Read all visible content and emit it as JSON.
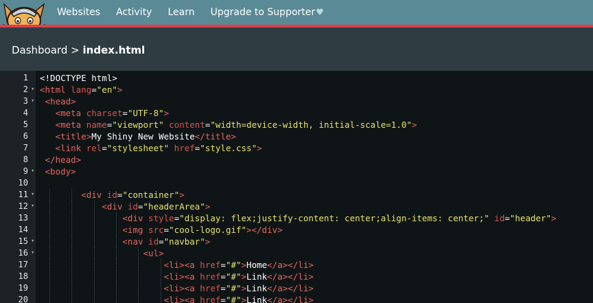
{
  "nav": {
    "items": [
      {
        "label": "Websites"
      },
      {
        "label": "Activity"
      },
      {
        "label": "Learn"
      },
      {
        "label": "Upgrade to Supporter"
      }
    ],
    "heart": "♥"
  },
  "breadcrumb": {
    "parent": "Dashboard",
    "separator": ">",
    "current": "index.html"
  },
  "editor": {
    "lines": [
      {
        "num": "1",
        "fold": "",
        "indent": 0,
        "tokens": [
          {
            "c": "x",
            "t": "<!DOCTYPE html>"
          }
        ]
      },
      {
        "num": "2",
        "fold": "▾",
        "indent": 0,
        "tokens": [
          {
            "c": "t",
            "t": "<html "
          },
          {
            "c": "a",
            "t": "lang"
          },
          {
            "c": "x",
            "t": "="
          },
          {
            "c": "s",
            "t": "\"en\""
          },
          {
            "c": "t",
            "t": ">"
          }
        ]
      },
      {
        "num": "3",
        "fold": "▾",
        "indent": 0,
        "tokens": [
          {
            "c": "t",
            "t": " <head>"
          }
        ]
      },
      {
        "num": "4",
        "fold": "",
        "indent": 0,
        "tokens": [
          {
            "c": "t",
            "t": "   <meta "
          },
          {
            "c": "a",
            "t": "charset"
          },
          {
            "c": "x",
            "t": "="
          },
          {
            "c": "s",
            "t": "\"UTF-8\""
          },
          {
            "c": "t",
            "t": ">"
          }
        ]
      },
      {
        "num": "5",
        "fold": "",
        "indent": 0,
        "tokens": [
          {
            "c": "t",
            "t": "   <meta "
          },
          {
            "c": "a",
            "t": "name"
          },
          {
            "c": "x",
            "t": "="
          },
          {
            "c": "s",
            "t": "\"viewport\""
          },
          {
            "c": "a",
            "t": " content"
          },
          {
            "c": "x",
            "t": "="
          },
          {
            "c": "s",
            "t": "\"width=device-width, initial-scale=1.0\""
          },
          {
            "c": "t",
            "t": ">"
          }
        ]
      },
      {
        "num": "6",
        "fold": "",
        "indent": 0,
        "tokens": [
          {
            "c": "t",
            "t": "   <title>"
          },
          {
            "c": "x",
            "t": "My Shiny New Website"
          },
          {
            "c": "t",
            "t": "</title>"
          }
        ]
      },
      {
        "num": "7",
        "fold": "",
        "indent": 0,
        "tokens": [
          {
            "c": "t",
            "t": "   <link "
          },
          {
            "c": "a",
            "t": "rel"
          },
          {
            "c": "x",
            "t": "="
          },
          {
            "c": "s",
            "t": "\"stylesheet\""
          },
          {
            "c": "a",
            "t": " href"
          },
          {
            "c": "x",
            "t": "="
          },
          {
            "c": "s",
            "t": "\"style.css\""
          },
          {
            "c": "t",
            "t": ">"
          }
        ]
      },
      {
        "num": "8",
        "fold": "",
        "indent": 0,
        "tokens": [
          {
            "c": "t",
            "t": " </head>"
          }
        ]
      },
      {
        "num": "9",
        "fold": "▾",
        "indent": 0,
        "tokens": [
          {
            "c": "t",
            "t": " <body>"
          }
        ]
      },
      {
        "num": "10",
        "fold": "",
        "indent": 0,
        "tokens": []
      },
      {
        "num": "11",
        "fold": "▾",
        "indent": 2,
        "tokens": [
          {
            "c": "t",
            "t": "        <div "
          },
          {
            "c": "a",
            "t": "id"
          },
          {
            "c": "x",
            "t": "="
          },
          {
            "c": "s",
            "t": "\"container\""
          },
          {
            "c": "t",
            "t": ">"
          }
        ]
      },
      {
        "num": "12",
        "fold": "▾",
        "indent": 3,
        "tokens": [
          {
            "c": "t",
            "t": "            <div "
          },
          {
            "c": "a",
            "t": "id"
          },
          {
            "c": "x",
            "t": "="
          },
          {
            "c": "s",
            "t": "\"headerArea\""
          },
          {
            "c": "t",
            "t": ">"
          }
        ]
      },
      {
        "num": "13",
        "fold": "",
        "indent": 4,
        "tokens": [
          {
            "c": "t",
            "t": "                <div "
          },
          {
            "c": "a",
            "t": "style"
          },
          {
            "c": "x",
            "t": "="
          },
          {
            "c": "s",
            "t": "\"display: flex;justify-content: center;align-items: center;\""
          },
          {
            "c": "a",
            "t": " id"
          },
          {
            "c": "x",
            "t": "="
          },
          {
            "c": "s",
            "t": "\"header\""
          },
          {
            "c": "t",
            "t": ">"
          }
        ]
      },
      {
        "num": "14",
        "fold": "",
        "indent": 4,
        "tokens": [
          {
            "c": "t",
            "t": "                <img "
          },
          {
            "c": "a",
            "t": "src"
          },
          {
            "c": "x",
            "t": "="
          },
          {
            "c": "s",
            "t": "\"cool-logo.gif\""
          },
          {
            "c": "t",
            "t": "></div>"
          }
        ]
      },
      {
        "num": "15",
        "fold": "▾",
        "indent": 4,
        "tokens": [
          {
            "c": "t",
            "t": "                <nav "
          },
          {
            "c": "a",
            "t": "id"
          },
          {
            "c": "x",
            "t": "="
          },
          {
            "c": "s",
            "t": "\"navbar\""
          },
          {
            "c": "t",
            "t": ">"
          }
        ]
      },
      {
        "num": "16",
        "fold": "▾",
        "indent": 5,
        "tokens": [
          {
            "c": "t",
            "t": "                    <ul>"
          }
        ]
      },
      {
        "num": "17",
        "fold": "",
        "indent": 6,
        "tokens": [
          {
            "c": "t",
            "t": "                        <li><a "
          },
          {
            "c": "a",
            "t": "href"
          },
          {
            "c": "x",
            "t": "="
          },
          {
            "c": "s",
            "t": "\"#\""
          },
          {
            "c": "t",
            "t": ">"
          },
          {
            "c": "x",
            "t": "Home"
          },
          {
            "c": "t",
            "t": "</a></li>"
          }
        ]
      },
      {
        "num": "18",
        "fold": "",
        "indent": 6,
        "tokens": [
          {
            "c": "t",
            "t": "                        <li><a "
          },
          {
            "c": "a",
            "t": "href"
          },
          {
            "c": "x",
            "t": "="
          },
          {
            "c": "s",
            "t": "\"#\""
          },
          {
            "c": "t",
            "t": ">"
          },
          {
            "c": "x",
            "t": "Link"
          },
          {
            "c": "t",
            "t": "</a></li>"
          }
        ]
      },
      {
        "num": "19",
        "fold": "",
        "indent": 6,
        "tokens": [
          {
            "c": "t",
            "t": "                        <li><a "
          },
          {
            "c": "a",
            "t": "href"
          },
          {
            "c": "x",
            "t": "="
          },
          {
            "c": "s",
            "t": "\"#\""
          },
          {
            "c": "t",
            "t": ">"
          },
          {
            "c": "x",
            "t": "Link"
          },
          {
            "c": "t",
            "t": "</a></li>"
          }
        ]
      },
      {
        "num": "20",
        "fold": "",
        "indent": 6,
        "tokens": [
          {
            "c": "t",
            "t": "                        <li><a "
          },
          {
            "c": "a",
            "t": "href"
          },
          {
            "c": "x",
            "t": "="
          },
          {
            "c": "s",
            "t": "\"#\""
          },
          {
            "c": "t",
            "t": ">"
          },
          {
            "c": "x",
            "t": "Link"
          },
          {
            "c": "t",
            "t": "</a></li>"
          }
        ]
      }
    ]
  },
  "colors": {
    "nav_bg": "#5a8a96",
    "accent_red": "#e03e4c",
    "crumb_bg": "#2f3d43",
    "editor_bg": "#0f1517",
    "tag": "#e8665f",
    "string": "#e8e26e"
  }
}
